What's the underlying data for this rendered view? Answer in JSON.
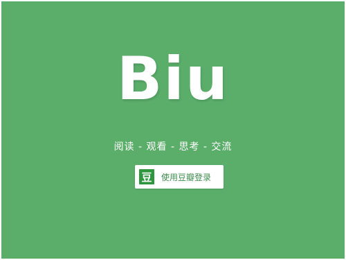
{
  "brand": {
    "logo_text": "Biu"
  },
  "tagline": "阅读 - 观看 - 思考 - 交流",
  "login": {
    "icon_glyph": "豆",
    "label": "使用豆瓣登录"
  },
  "colors": {
    "background": "#5aae6a",
    "douban_green": "#2d963f",
    "button_text": "#3f8f4e"
  },
  "icons": {
    "login_icon": "douban-icon"
  }
}
